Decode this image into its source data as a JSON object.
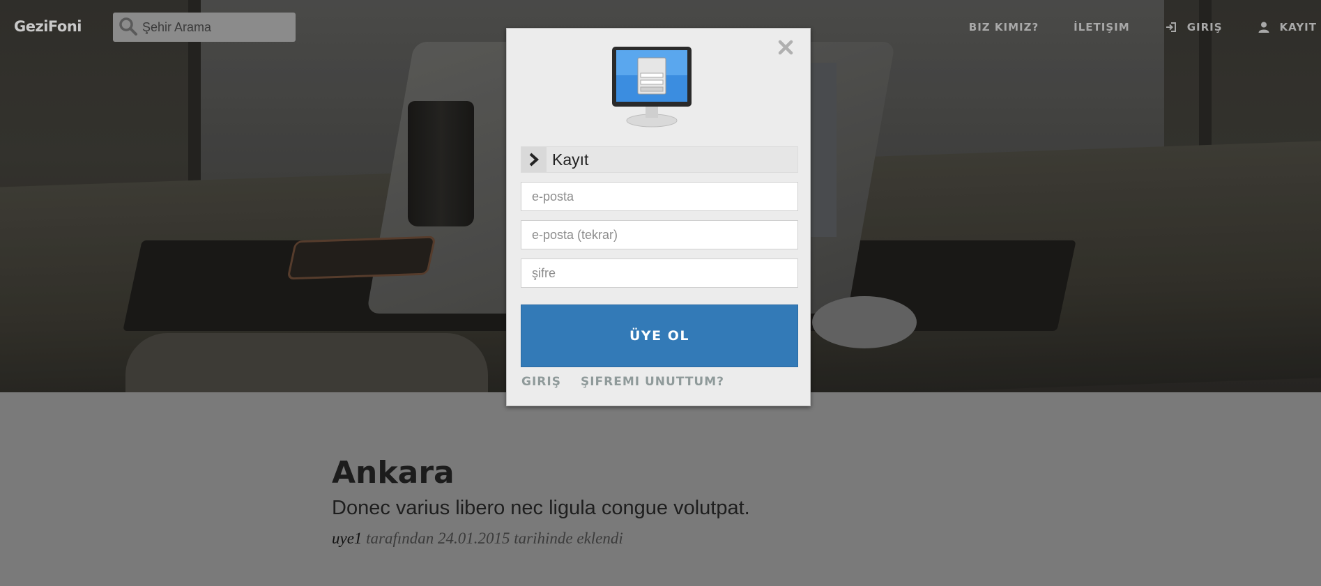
{
  "nav": {
    "logo": "GeziFoni",
    "search_placeholder": "Şehir Arama",
    "links": [
      {
        "label": "BIZ KIMIZ?",
        "icon": ""
      },
      {
        "label": "İLETIŞIM",
        "icon": ""
      },
      {
        "label": "GIRIŞ",
        "icon": "sign-in-icon"
      },
      {
        "label": "KAYIT",
        "icon": "user-icon"
      }
    ]
  },
  "modal": {
    "section_title": "Kayıt",
    "email_placeholder": "e-posta",
    "email_repeat_placeholder": "e-posta (tekrar)",
    "password_placeholder": "şifre",
    "submit_label": "ÜYE OL",
    "login_link": "GIRIŞ",
    "forgot_link": "ŞIFREMI UNUTTUM?"
  },
  "post": {
    "title": "Ankara",
    "subtitle": "Donec varius libero nec ligula congue volutpat.",
    "author": "uye1",
    "meta_suffix": "tarafından 24.01.2015 tarihinde eklendi"
  },
  "colors": {
    "primary_button": "#337ab7",
    "modal_bg": "#ececec",
    "nav_text": "#a9a9a9"
  }
}
